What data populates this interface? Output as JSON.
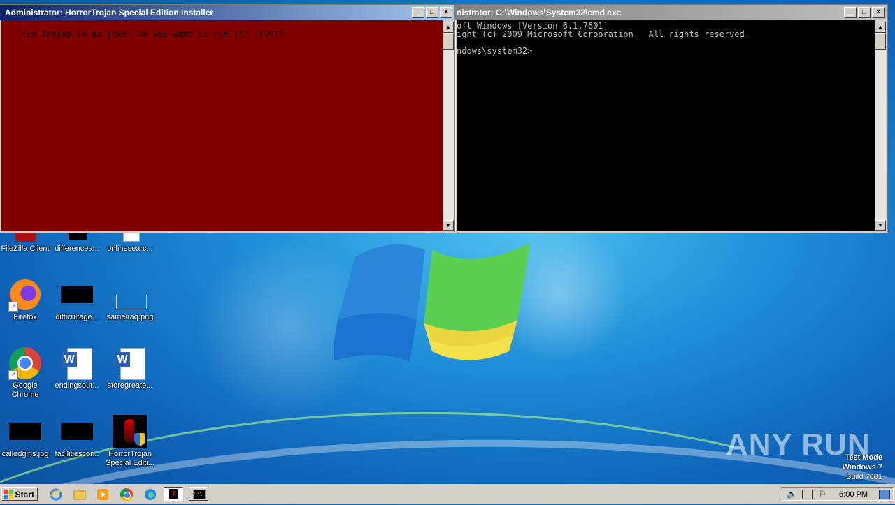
{
  "desktop": {
    "icons": [
      {
        "label": "FileZilla Client",
        "icon": "filezilla-icon"
      },
      {
        "label": "differencea...",
        "icon": "black-image-icon"
      },
      {
        "label": "onlinesearc...",
        "icon": "document-icon"
      },
      {
        "label": "Firefox",
        "icon": "firefox-icon"
      },
      {
        "label": "difficultage...",
        "icon": "black-image-icon"
      },
      {
        "label": "sameiraq.png",
        "icon": "image-file-icon"
      },
      {
        "label": "Google Chrome",
        "icon": "chrome-icon"
      },
      {
        "label": "endingsout...",
        "icon": "word-doc-icon"
      },
      {
        "label": "storegreate...",
        "icon": "word-doc-icon"
      },
      {
        "label": "calledgirls.jpg",
        "icon": "black-image-icon"
      },
      {
        "label": "facilitiescor...",
        "icon": "black-image-icon"
      },
      {
        "label": "HorrorTrojan Special Editi...",
        "icon": "horrortrojan-exe-icon"
      }
    ],
    "watermark": {
      "line1": "Test Mode",
      "line2": "Windows 7",
      "line3": "Build 7601"
    },
    "brand": "ANY RUN"
  },
  "windows": {
    "installer": {
      "title": "Administrator:  HorrorTrojan Special Edition Installer",
      "text": "his Trojan is no joke! Do you want to run it? [Y,N]?",
      "bg": "#800000",
      "fg": "#000000"
    },
    "cmd": {
      "title": "nistrator: C:\\Windows\\System32\\cmd.exe",
      "lines": [
        "oft Windows [Version 6.1.7601]",
        "ight (c) 2009 Microsoft Corporation.  All rights reserved.",
        "",
        "ndows\\system32>"
      ],
      "bg": "#000000",
      "fg": "#c0c0c0"
    }
  },
  "taskbar": {
    "start_label": "Start",
    "quicklaunch": [
      "ie-icon",
      "explorer-icon",
      "media-player-icon",
      "chrome-icon",
      "edge-icon"
    ],
    "tasks": [
      "horrortrojan-task",
      "cmd-task"
    ],
    "clock": "6:00 PM"
  }
}
